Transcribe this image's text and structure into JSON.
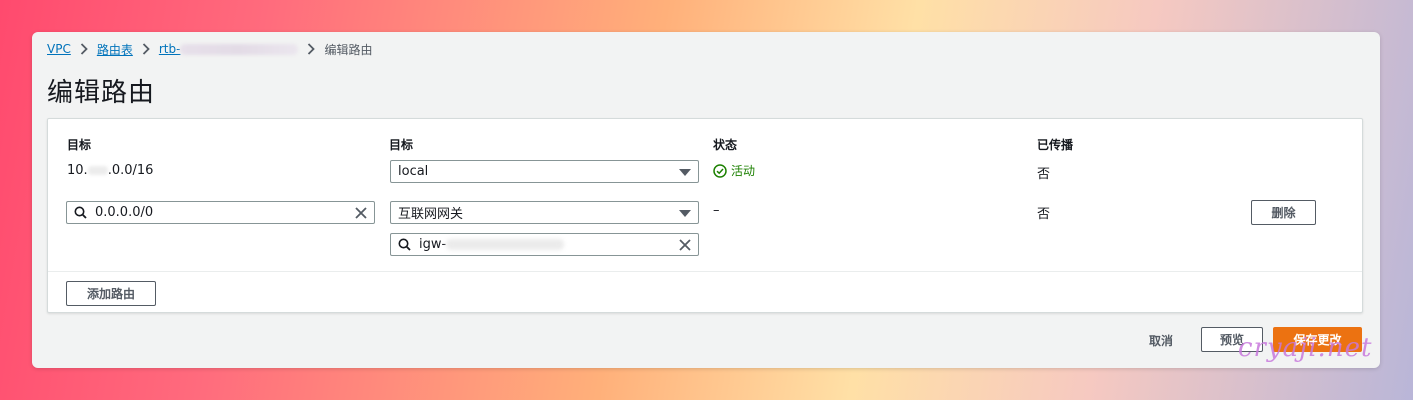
{
  "breadcrumb": {
    "items": [
      "VPC",
      "路由表",
      "rtb-"
    ],
    "current": "编辑路由"
  },
  "page": {
    "title": "编辑路由"
  },
  "table": {
    "headers": [
      "目标",
      "目标",
      "状态",
      "已传播"
    ],
    "rows": [
      {
        "destination": "10.",
        "destination_suffix": ".0.0/16",
        "target_select": "local",
        "status": "活动",
        "propagated": "否"
      },
      {
        "destination_input": "0.0.0.0/0",
        "target_select": "互联网网关",
        "target_search": "igw-",
        "status": "–",
        "propagated": "否",
        "remove_label": "删除"
      }
    ],
    "add_route_label": "添加路由"
  },
  "footer": {
    "cancel_label": "取消",
    "preview_label": "预览",
    "save_label": "保存更改"
  },
  "watermark": "cryaji.net",
  "colors": {
    "link": "#0073bb",
    "success": "#1d8102",
    "primary": "#ec7211",
    "border": "#879596"
  }
}
